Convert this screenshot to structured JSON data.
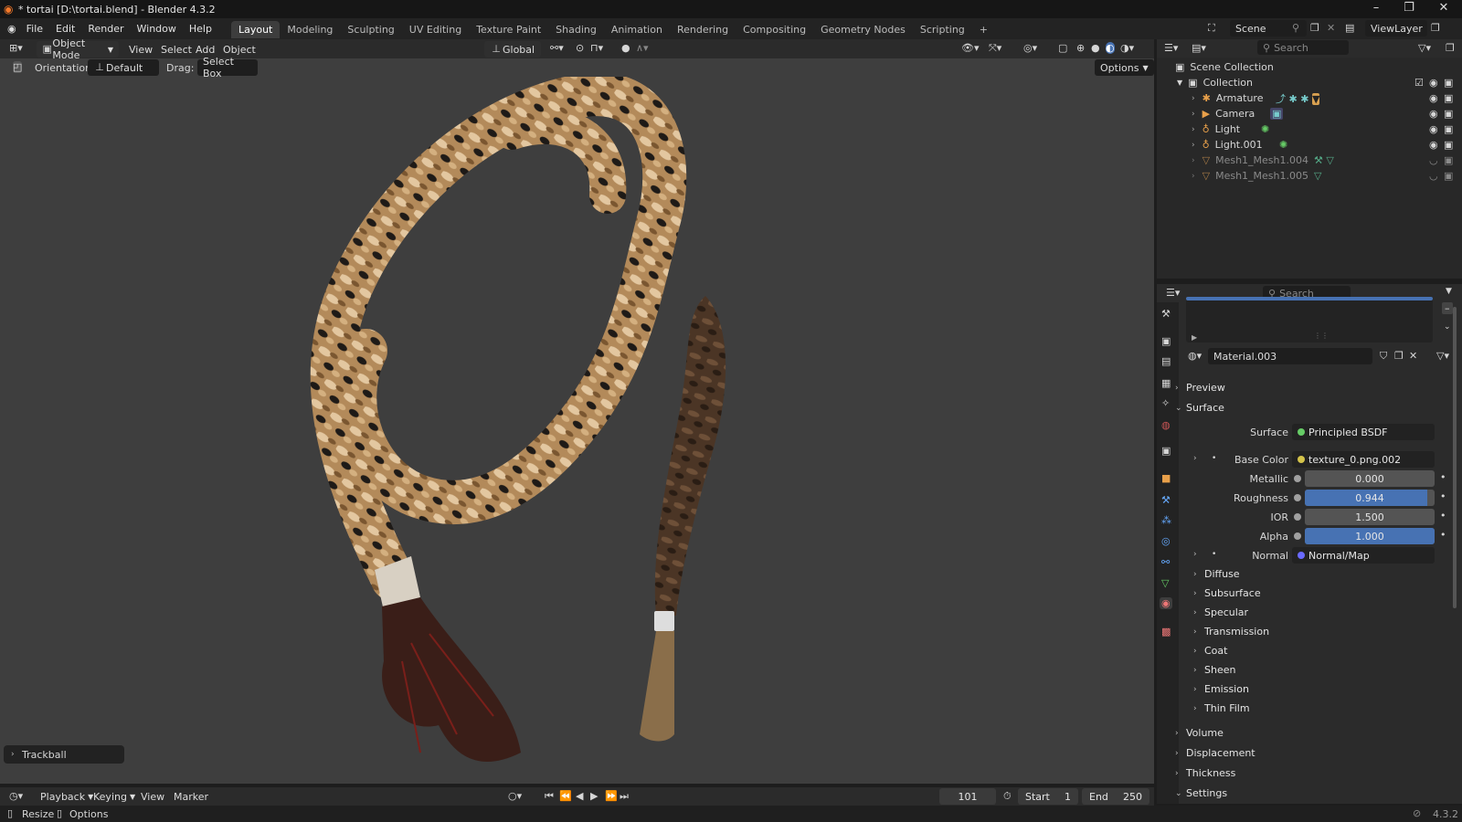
{
  "title": "* tortai [D:\\tortai.blend] - Blender 4.3.2",
  "menus": [
    "File",
    "Edit",
    "Render",
    "Window",
    "Help"
  ],
  "workspaces": [
    "Layout",
    "Modeling",
    "Sculpting",
    "UV Editing",
    "Texture Paint",
    "Shading",
    "Animation",
    "Rendering",
    "Compositing",
    "Geometry Nodes",
    "Scripting"
  ],
  "scene": "Scene",
  "view_layer": "ViewLayer",
  "viewport_header": {
    "mode": "Object Mode",
    "menus": [
      "View",
      "Select",
      "Add",
      "Object"
    ],
    "transform": "Global",
    "orientation_label": "Orientation:",
    "orientation_value": "Default",
    "drag_label": "Drag:",
    "drag_value": "Select Box",
    "options": "Options"
  },
  "operator_panel": "Trackball",
  "outliner": {
    "search_placeholder": "Search",
    "scene_collection": "Scene Collection",
    "collection": "Collection",
    "items": [
      "Armature",
      "Camera",
      "Light",
      "Light.001",
      "Mesh1_Mesh1.004",
      "Mesh1_Mesh1.005"
    ]
  },
  "properties": {
    "search_placeholder": "Search",
    "material": "Material.003",
    "sections_top": [
      "Preview",
      "Surface"
    ],
    "surface_label": "Surface",
    "surface_value": "Principled BSDF",
    "base_color_label": "Base Color",
    "base_color_value": "texture_0.png.002",
    "metallic_label": "Metallic",
    "metallic_value": "0.000",
    "roughness_label": "Roughness",
    "roughness_value": "0.944",
    "roughness_fraction": 0.944,
    "ior_label": "IOR",
    "ior_value": "1.500",
    "alpha_label": "Alpha",
    "alpha_value": "1.000",
    "alpha_fraction": 1.0,
    "normal_label": "Normal",
    "normal_value": "Normal/Map",
    "subsections": [
      "Diffuse",
      "Subsurface",
      "Specular",
      "Transmission",
      "Coat",
      "Sheen",
      "Emission",
      "Thin Film"
    ],
    "sections_bottom": [
      "Volume",
      "Displacement",
      "Thickness",
      "Settings"
    ]
  },
  "timeline": {
    "menus": [
      "Playback",
      "Keying",
      "View",
      "Marker"
    ],
    "current_frame": "101",
    "start_label": "Start",
    "start": "1",
    "end_label": "End",
    "end": "250"
  },
  "status": {
    "left1": "Resize",
    "left2": "Options",
    "version": "4.3.2"
  },
  "colors": {
    "accent": "#4772b3",
    "viewport_bg": "#3e3e3e"
  }
}
